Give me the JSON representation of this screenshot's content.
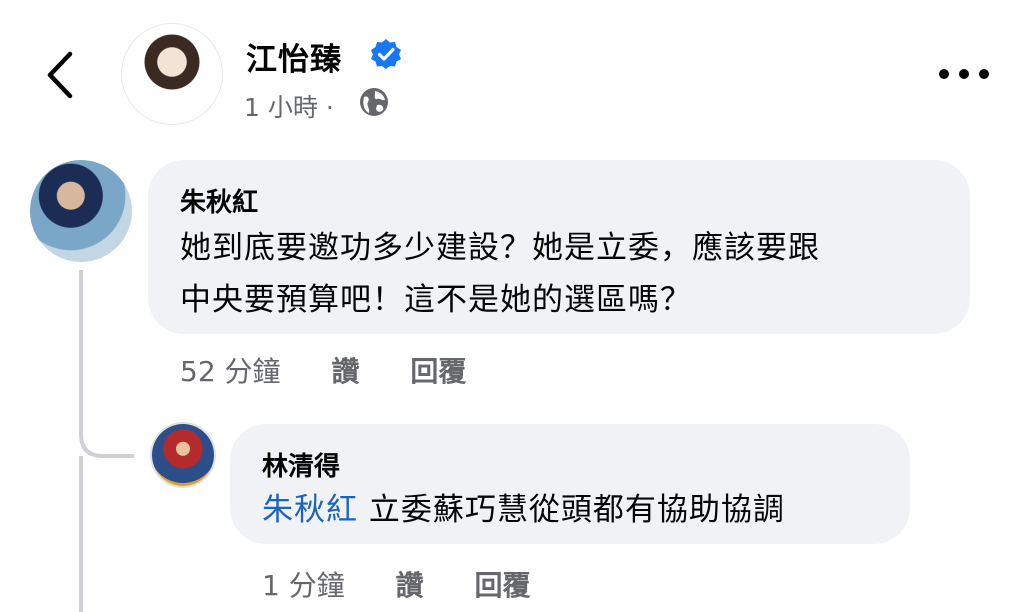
{
  "post": {
    "author": "江怡臻",
    "time": "1 小時",
    "separator": "·"
  },
  "icons": {
    "back": "chevron-left-icon",
    "verified": "verified-badge-icon",
    "privacy": "globe-icon",
    "more": "more-dots-icon"
  },
  "colors": {
    "verified": "#1877f2",
    "mention": "#1a63c4",
    "bubble": "#f0f2f5",
    "meta": "#65676b"
  },
  "comments": [
    {
      "author": "朱秋紅",
      "line1": "她到底要邀功多少建設？她是立委，應該要跟",
      "line2": "中央要預算吧！這不是她的選區嗎？",
      "time": "52 分鐘",
      "like": "讚",
      "reply": "回覆"
    }
  ],
  "replies": [
    {
      "author": "林清得",
      "mention": "朱秋紅",
      "text": "立委蘇巧慧從頭都有協助協調",
      "time": "1 分鐘",
      "like": "讚",
      "reply": "回覆"
    }
  ]
}
